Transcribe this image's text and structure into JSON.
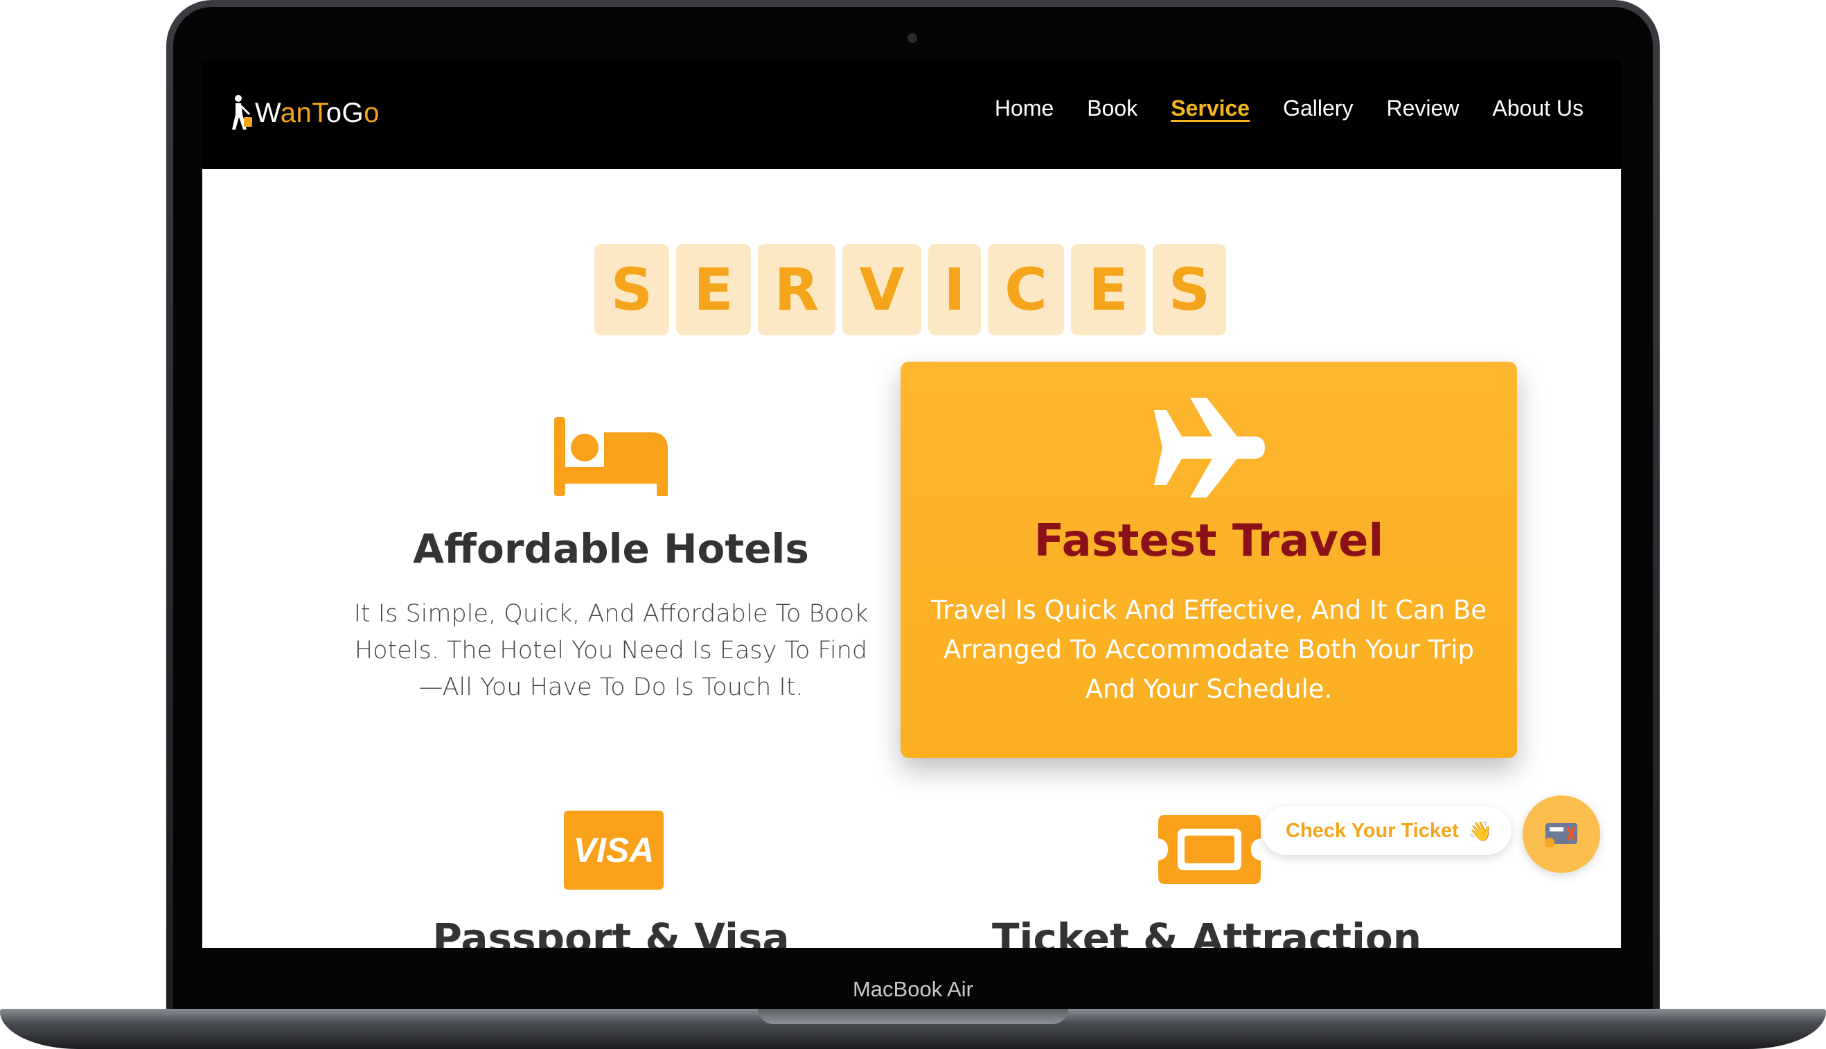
{
  "device": {
    "label": "MacBook Air"
  },
  "brand": {
    "logo_prefix": "W",
    "logo_name_1": "an",
    "logo_name_2": "T",
    "logo_name_3": "o",
    "logo_name_4": "G",
    "logo_name_5": "o"
  },
  "nav": {
    "items": [
      {
        "label": "Home"
      },
      {
        "label": "Book"
      },
      {
        "label": "Service",
        "active": true
      },
      {
        "label": "Gallery"
      },
      {
        "label": "Review"
      },
      {
        "label": "About Us"
      }
    ]
  },
  "heading": {
    "letters": [
      "S",
      "E",
      "R",
      "V",
      "I",
      "C",
      "E",
      "S"
    ]
  },
  "services": {
    "hotels": {
      "icon": "bed-icon",
      "title": "Affordable Hotels",
      "desc_1": "It Is Simple, Quick, And Affordable To Book",
      "desc_2": "Hotels. The Hotel You Need Is Easy To Find",
      "desc_3": "—All You Have To Do Is Touch It."
    },
    "travel": {
      "icon": "airplane-icon",
      "title": "Fastest Travel",
      "desc_1": "Travel Is Quick And Effective, And It Can Be",
      "desc_2": "Arranged To Accommodate Both Your Trip",
      "desc_3": "And Your Schedule."
    },
    "visa": {
      "icon": "visa-icon",
      "icon_text": "VISA",
      "title": "Passport & Visa"
    },
    "ticket": {
      "icon": "ticket-icon",
      "title": "Ticket & Attraction"
    }
  },
  "widget": {
    "label": "Check Your Ticket",
    "emoji": "👋"
  },
  "colors": {
    "accent": "#f5a51b",
    "featured_title": "#8b1119",
    "tile_bg": "#fde8c5",
    "nav_bg": "#000000"
  }
}
